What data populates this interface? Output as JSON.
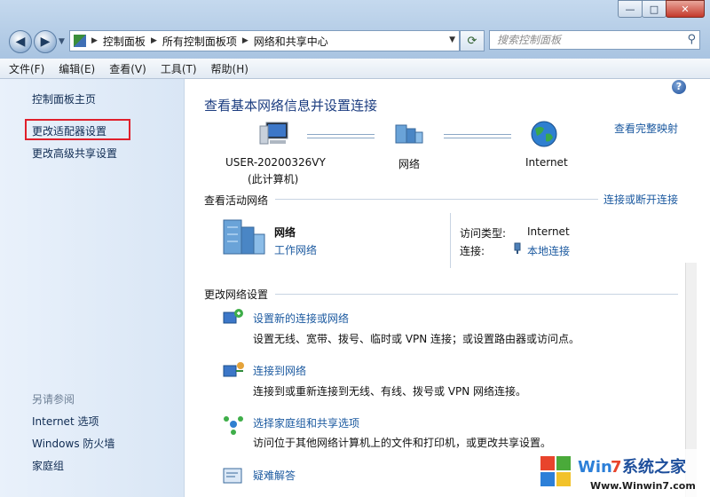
{
  "window": {
    "buttons": {
      "minimize": "—",
      "maximize": "□",
      "close": "✕"
    },
    "nav": {
      "back": "◀",
      "forward": "▶"
    },
    "address": {
      "crumbs": [
        "控制面板",
        "所有控制面板项",
        "网络和共享中心"
      ]
    },
    "search": {
      "placeholder": "搜索控制面板"
    }
  },
  "menu": [
    "文件(F)",
    "编辑(E)",
    "查看(V)",
    "工具(T)",
    "帮助(H)"
  ],
  "sidebar": {
    "items": [
      "控制面板主页",
      "更改适配器设置",
      "更改高级共享设置"
    ],
    "see_also_title": "另请参阅",
    "see_also": [
      "Internet 选项",
      "Windows 防火墙",
      "家庭组"
    ],
    "highlight_color": "#e0202c"
  },
  "main": {
    "title": "查看基本网络信息并设置连接",
    "full_map": "查看完整映射",
    "map": {
      "computer": "USER-20200326VY",
      "computer_sub": "(此计算机)",
      "network": "网络",
      "internet": "Internet"
    },
    "active": {
      "title": "查看活动网络",
      "connect_link": "连接或断开连接",
      "network_name": "网络",
      "network_type": "工作网络",
      "access_type_label": "访问类型:",
      "access_type_value": "Internet",
      "connection_label": "连接:",
      "connection_value": "本地连接"
    },
    "change": {
      "title": "更改网络设置",
      "items": [
        {
          "link": "设置新的连接或网络",
          "desc": "设置无线、宽带、拨号、临时或 VPN 连接；或设置路由器或访问点。"
        },
        {
          "link": "连接到网络",
          "desc": "连接到或重新连接到无线、有线、拨号或 VPN 网络连接。"
        },
        {
          "link": "选择家庭组和共享选项",
          "desc": "访问位于其他网络计算机上的文件和打印机，或更改共享设置。"
        },
        {
          "link": "疑难解答",
          "desc": ""
        }
      ]
    }
  },
  "watermark": {
    "brand": "Win7系统之家",
    "url": "Www.Winwin7.com"
  },
  "colors": {
    "link": "#1c5aa0",
    "title": "#1c3d80",
    "sidebar": "#e3edf8"
  }
}
